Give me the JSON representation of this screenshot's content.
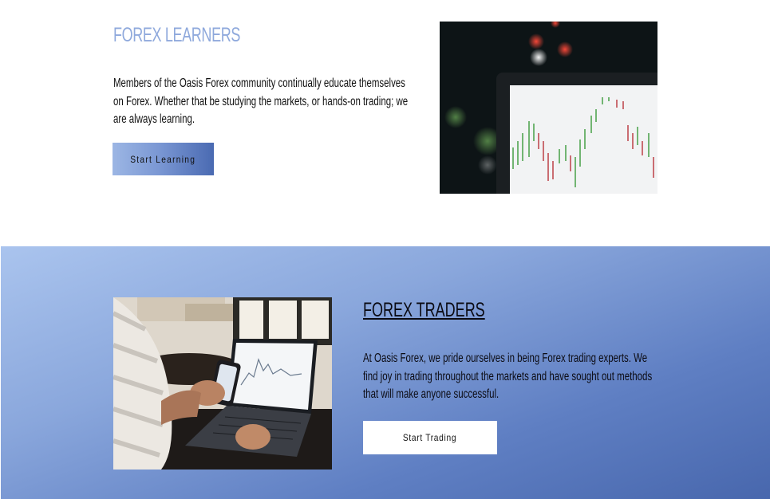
{
  "learners": {
    "title": "FOREX LEARNERS",
    "text": "Members of the Oasis Forex community continually educate themselves on Forex. Whether that be studying the markets, or hands-on trading; we are always learning.",
    "button_label": "Start Learning",
    "image_icon": "candlestick-chart-photo"
  },
  "traders": {
    "title": "FOREX TRADERS",
    "text": "At Oasis Forex, we pride ourselves in being Forex trading experts. We find joy in trading throughout the markets and have sought out methods that will make anyone successful.",
    "button_label": "Start Trading",
    "image_icon": "laptop-trading-photo"
  },
  "colors": {
    "title_accent": "#8fa9dc",
    "band_start": "#aac4ee",
    "band_end": "#4867ad"
  }
}
